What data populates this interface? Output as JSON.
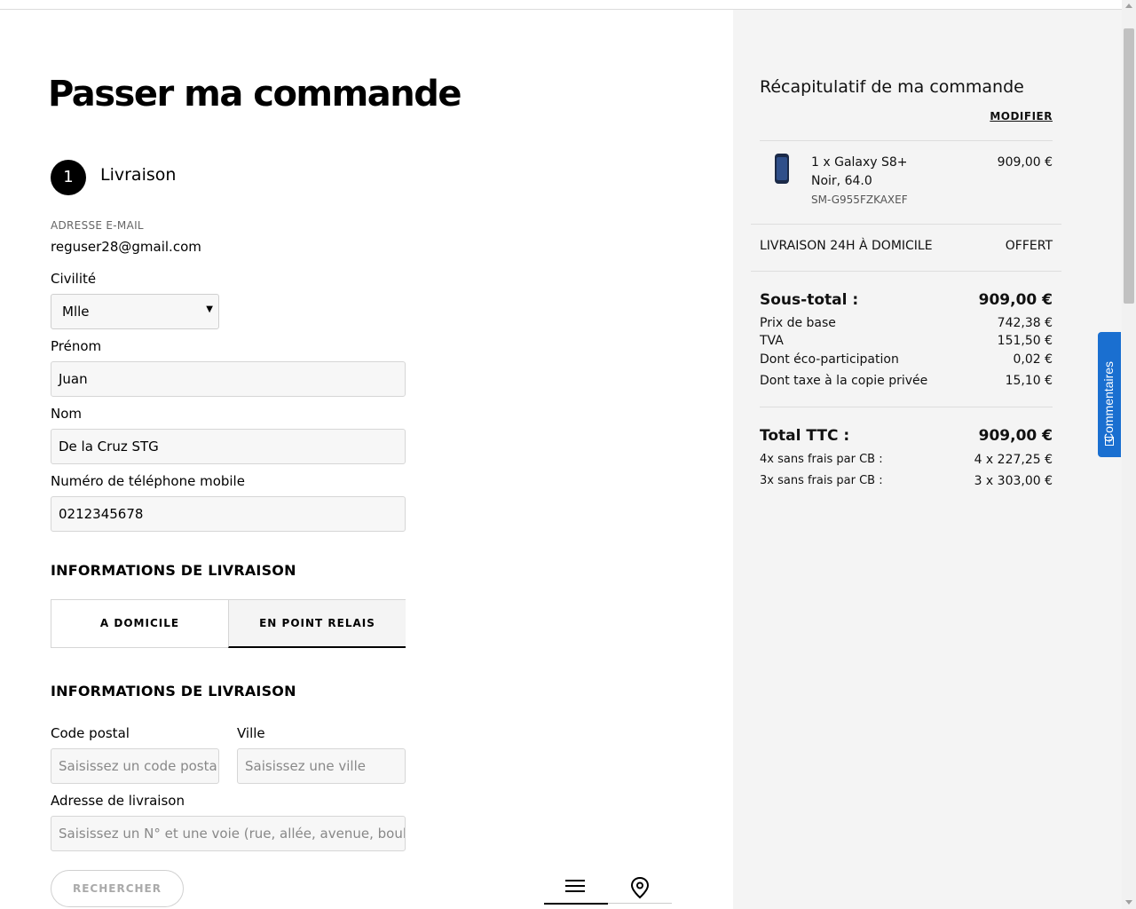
{
  "page": {
    "title": "Passer ma commande"
  },
  "step": {
    "number": "1",
    "label": "Livraison"
  },
  "email": {
    "label": "ADRESSE E-MAIL",
    "value": "reguser28@gmail.com"
  },
  "civility": {
    "label": "Civilité",
    "value": "Mlle"
  },
  "first_name": {
    "label": "Prénom",
    "value": "Juan"
  },
  "last_name": {
    "label": "Nom",
    "value": "De la Cruz STG"
  },
  "phone": {
    "label": "Numéro de téléphone mobile",
    "value": "0212345678"
  },
  "delivery_info": {
    "heading": "INFORMATIONS DE LIVRAISON",
    "tabs": [
      {
        "label": "A DOMICILE"
      },
      {
        "label": "EN POINT RELAIS"
      }
    ]
  },
  "address": {
    "heading": "INFORMATIONS DE LIVRAISON",
    "postal_label": "Code postal",
    "postal_placeholder": "Saisissez un code postal",
    "city_label": "Ville",
    "city_placeholder": "Saisissez une ville",
    "address_label": "Adresse de livraison",
    "address_placeholder": "Saisissez un N° et une voie (rue, allée, avenue, boulevard...)",
    "search_button": "RECHERCHER"
  },
  "summary": {
    "title": "Récapitulatif de ma commande",
    "modify": "MODIFIER",
    "product": {
      "name": "1 x Galaxy S8+",
      "variant": "Noir, 64.0",
      "sku": "SM-G955FZKAXEF",
      "price": "909,00 €"
    },
    "shipping": {
      "label": "LIVRAISON 24H À DOMICILE",
      "value": "OFFERT"
    },
    "subtotal": {
      "label": "Sous-total :",
      "value": "909,00 €"
    },
    "base_price": {
      "label": "Prix de base",
      "value": "742,38 €"
    },
    "tva": {
      "label": "TVA",
      "value": "151,50 €"
    },
    "eco": {
      "label": "Dont éco-participation",
      "value": "0,02 €"
    },
    "copy_tax": {
      "label": "Dont taxe à la copie privée",
      "value": "15,10 €"
    },
    "total": {
      "label": "Total TTC :",
      "value": "909,00 €"
    },
    "installments_4": {
      "label": "4x sans frais par CB :",
      "value": "4 x 227,25 €"
    },
    "installments_3": {
      "label": "3x sans frais par CB :",
      "value": "3 x 303,00 €"
    }
  },
  "feedback": {
    "label": "Commentaires"
  },
  "colors": {
    "accent": "#1a6fd0",
    "sidebar_bg": "#f4f4f4"
  },
  "icons": {
    "list_view": "list-icon",
    "map_view": "location-pin-icon",
    "feedback": "plus-icon"
  }
}
